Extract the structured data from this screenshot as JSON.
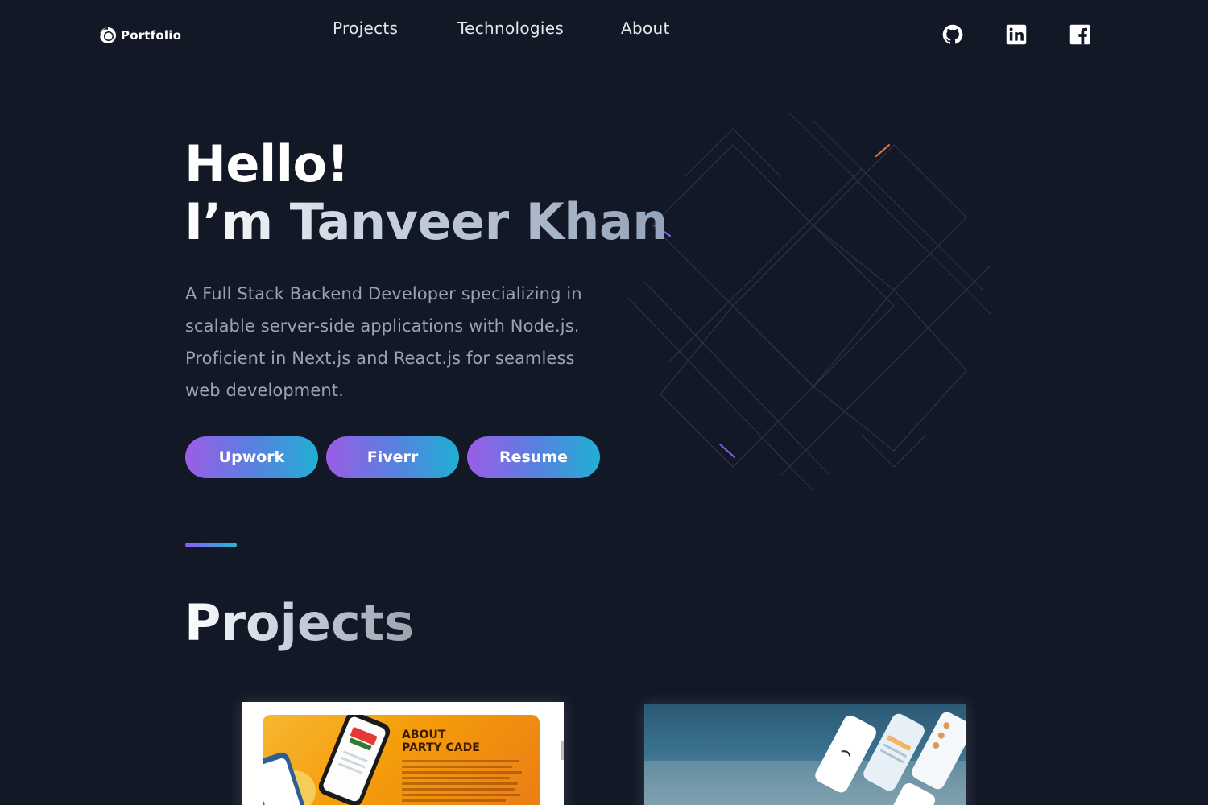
{
  "nav": {
    "brand": "Portfolio",
    "links": [
      "Projects",
      "Technologies",
      "About"
    ],
    "social": [
      "github-icon",
      "linkedin-icon",
      "facebook-icon"
    ]
  },
  "hero": {
    "greeting": "Hello!",
    "name_line": "I’m Tanveer Khan",
    "description": "A Full Stack Backend Developer specializing in scalable server-side applications with Node.js. Proficient in Next.js and React.js for seamless web development.",
    "buttons": [
      "Upwork",
      "Fiverr",
      "Resume"
    ]
  },
  "projects": {
    "title": "Projects",
    "card1": {
      "heading_line1": "ABOUT",
      "heading_line2": "PARTY CADE"
    }
  },
  "colors": {
    "background": "#121826",
    "accent_start": "#9b5de5",
    "accent_end": "#1fb0d3"
  }
}
